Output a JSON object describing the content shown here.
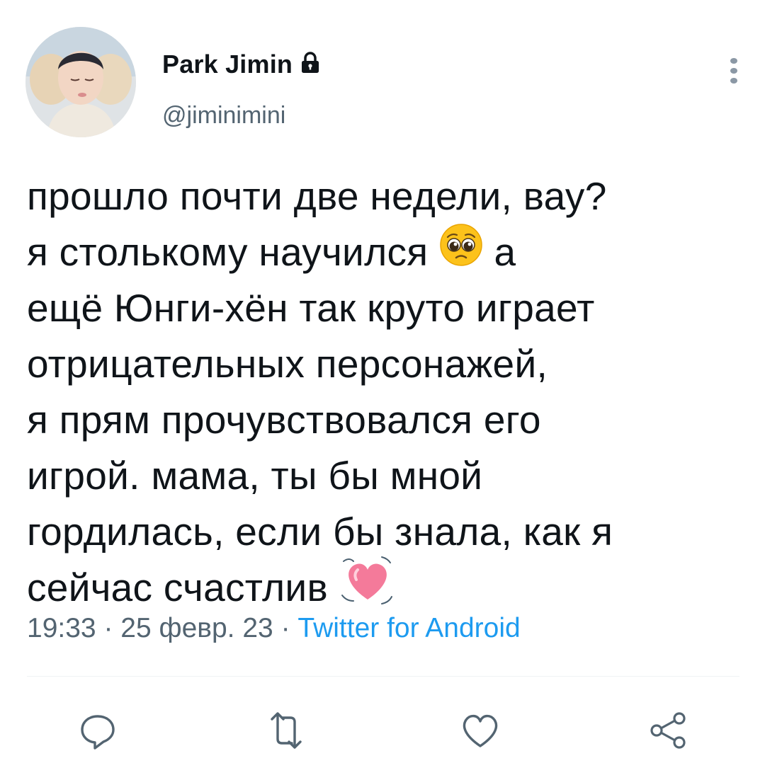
{
  "author": {
    "display_name": "Park Jimin",
    "handle": "@jiminimini",
    "protected_icon": "lock-icon",
    "avatar": "profile-photo"
  },
  "header": {
    "more_icon": "more-vertical-icon"
  },
  "tweet": {
    "lines": [
      "прошло почти две недели, вау?",
      "я столькому научился",
      "а",
      "ещё Юнги-хён так круто играет",
      "отрицательных персонажей,",
      "я прям прочувствовался его",
      "игрой. мама, ты бы мной",
      "гордилась, если бы знала, как я",
      "сейчас счастлив"
    ],
    "emojis": [
      "pleading-face-emoji",
      "beating-heart-emoji"
    ]
  },
  "meta": {
    "time": "19:33",
    "separator": " · ",
    "date": "25 февр. 23",
    "source": "Twitter for Android"
  },
  "actions": [
    {
      "name": "reply",
      "icon": "reply-icon"
    },
    {
      "name": "retweet",
      "icon": "retweet-icon"
    },
    {
      "name": "like",
      "icon": "heart-icon"
    },
    {
      "name": "share",
      "icon": "share-icon"
    }
  ],
  "colors": {
    "text": "#0f1419",
    "secondary": "#536471",
    "accent": "#1d9bf0",
    "divider": "#eff3f4"
  }
}
